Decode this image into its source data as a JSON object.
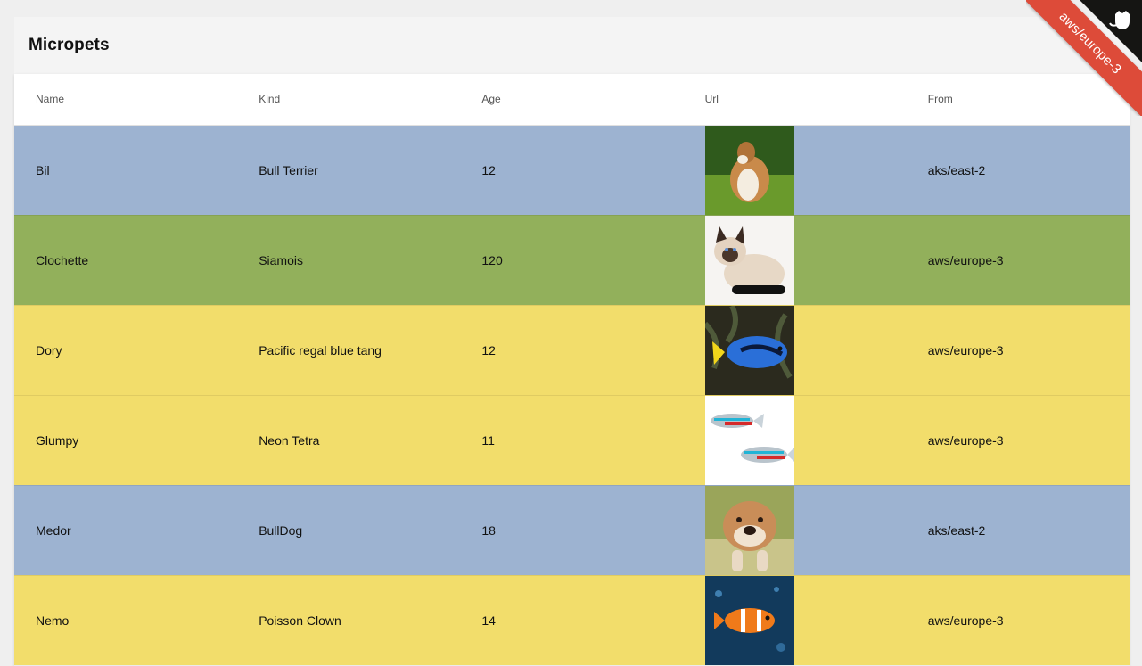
{
  "app": {
    "title": "Micropets"
  },
  "ribbon": {
    "label": "aws/europe-3"
  },
  "table": {
    "headers": [
      "Name",
      "Kind",
      "Age",
      "Url",
      "From"
    ],
    "rows": [
      {
        "name": "Bil",
        "kind": "Bull Terrier",
        "age": "12",
        "image": "collie-dog-photo",
        "from": "aks/east-2",
        "color": "#9db3d1"
      },
      {
        "name": "Clochette",
        "kind": "Siamois",
        "age": "120",
        "image": "siamese-cat-photo",
        "from": "aws/europe-3",
        "color": "#92b05b"
      },
      {
        "name": "Dory",
        "kind": "Pacific regal blue tang",
        "age": "12",
        "image": "blue-tang-fish-photo",
        "from": "aws/europe-3",
        "color": "#f2dd6b"
      },
      {
        "name": "Glumpy",
        "kind": "Neon Tetra",
        "age": "11",
        "image": "neon-tetra-fish-photo",
        "from": "aws/europe-3",
        "color": "#f2dd6b"
      },
      {
        "name": "Medor",
        "kind": "BullDog",
        "age": "18",
        "image": "bulldog-photo",
        "from": "aks/east-2",
        "color": "#9db3d1"
      },
      {
        "name": "Nemo",
        "kind": "Poisson Clown",
        "age": "14",
        "image": "clownfish-photo",
        "from": "aws/europe-3",
        "color": "#f2dd6b"
      }
    ]
  }
}
